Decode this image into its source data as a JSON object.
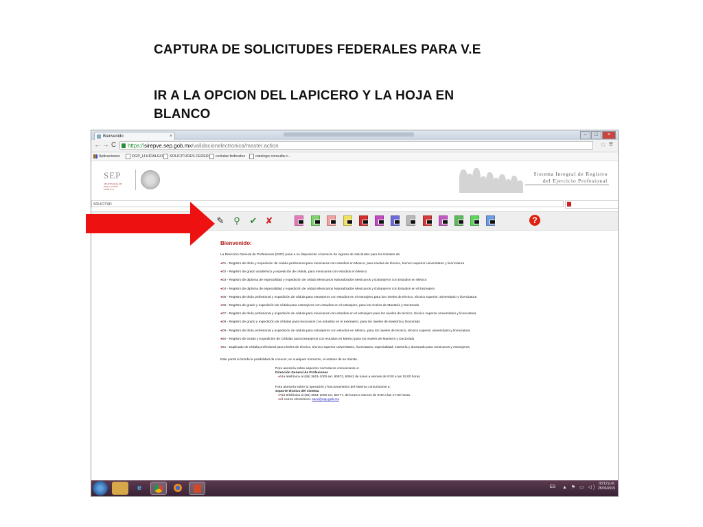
{
  "slide": {
    "title_line1": "CAPTURA DE SOLICITUDES FEDERALES PARA V.E",
    "title_line2": "IR A LA OPCION DEL LAPICERO Y LA HOJA EN BLANCO"
  },
  "browser": {
    "tab_title": "Bienvenido",
    "tab_close": "×",
    "url_https": "https://",
    "url_domain": "sirepve.sep.gob.mx",
    "url_path": "/validacionelectronica/master.action",
    "nav_back": "←",
    "nav_forward": "→",
    "nav_reload": "C",
    "star": "☆",
    "menu": "≡",
    "bookmarks": [
      {
        "label": "Aplicaciones"
      },
      {
        "label": "DGP_H HIDALGO"
      },
      {
        "label": "SOLICITUDES FEDER..."
      },
      {
        "label": "cedulas federales"
      },
      {
        "label": "catalogo consulta c..."
      }
    ]
  },
  "site": {
    "sep_logo": "SEP",
    "sep_sub": "SECRETARÍA DE EDUCACIÓN PÚBLICA",
    "system_title_line1": "Sistema Integral de Registro",
    "system_title_line2": "del Ejercicio Profesional",
    "search_label": "SOLICITUD"
  },
  "content": {
    "welcome": "Bienvenido:",
    "intro": "La Dirección General de Profesiones (DGP) pone a su disposición el servicio de ingreso de solicitudes para los trámites de:",
    "items": [
      "01 - Registro de título y expedición de cédula profesional para mexicanos con estudios en México, para niveles de técnico, técnico superior universitario y licenciatura",
      "02 - Registro de grado académico y expedición de cédula, para mexicanos con estudios en México",
      "03 - Registro de diploma de especialidad y expedición de cédula Mexicanos Naturalizados Mexicanos y Extranjeros con Estudios en México",
      "04 - Registro de diploma de especialidad y expedición de cédula Mexicanos Naturalizados Mexicanos y Extranjeros con Estudios en el Extranjero",
      "05 - Registro de título profesional y expedición de cédula para extranjeros con estudios en el extranjero para los niveles de técnico, técnico superior universitario y licenciatura",
      "06 - Registro de grado y expedición de cédula para extranjeros con estudios en el extranjero, para los niveles de Maestría y Doctorado",
      "07 - Registro de título profesional y expedición de cédula para mexicanos con estudios en el extranjero para los niveles de técnico, técnico superior universitario y licenciatura",
      "08 - Registro de grado y expedición de cédulas para mexicanos con estudios en el extranjero, para los niveles de Maestría y Doctorado",
      "09 - Registro de título profesional y expedición de cédula para extranjeros con estudios en México, para los niveles de técnico, técnico superior universitario y licenciatura",
      "60 - Registro de Grado y Expedición de Cédulas para Extranjeros con estudios en México para los niveles de Maestría y Doctorado",
      "61 - Duplicado de cédula profesional para niveles de técnico, técnico superior universitario, licenciatura, especialidad, maestría y doctorado para mexicanos y extranjeros"
    ],
    "closing": "Este portal le brinda la posibilidad de conocer, en cualquier momento, el estatus de su trámite.",
    "advice1_intro": "Para asesoría sobre aspectos normativos comunicarse a:",
    "advice1_org": "Dirección General de Profesiones",
    "advice1_phone": "Vía telefónica al (55) 3601-1000  ext. 60973, 60942  de lunes a viernes de 9:00 a las 15:00 horas",
    "advice2_intro": "Para asesoría sobre la operación y funcionamiento del sistema comunicarse a:",
    "advice2_org": "Soporte técnico del sistema",
    "advice2_phone": "Vía telefónica al (55) 3601-1000  ext. 55777, de lunes a viernes de 9:00 a las  17:00 horas.",
    "advice2_email_label": "Al correo electrónico:",
    "advice2_email": "sacv@sep.gob.mx"
  },
  "taskbar": {
    "lang": "ES",
    "time": "03:12 p.m.",
    "date": "25/03/2015"
  },
  "icons": {
    "help": "?"
  }
}
